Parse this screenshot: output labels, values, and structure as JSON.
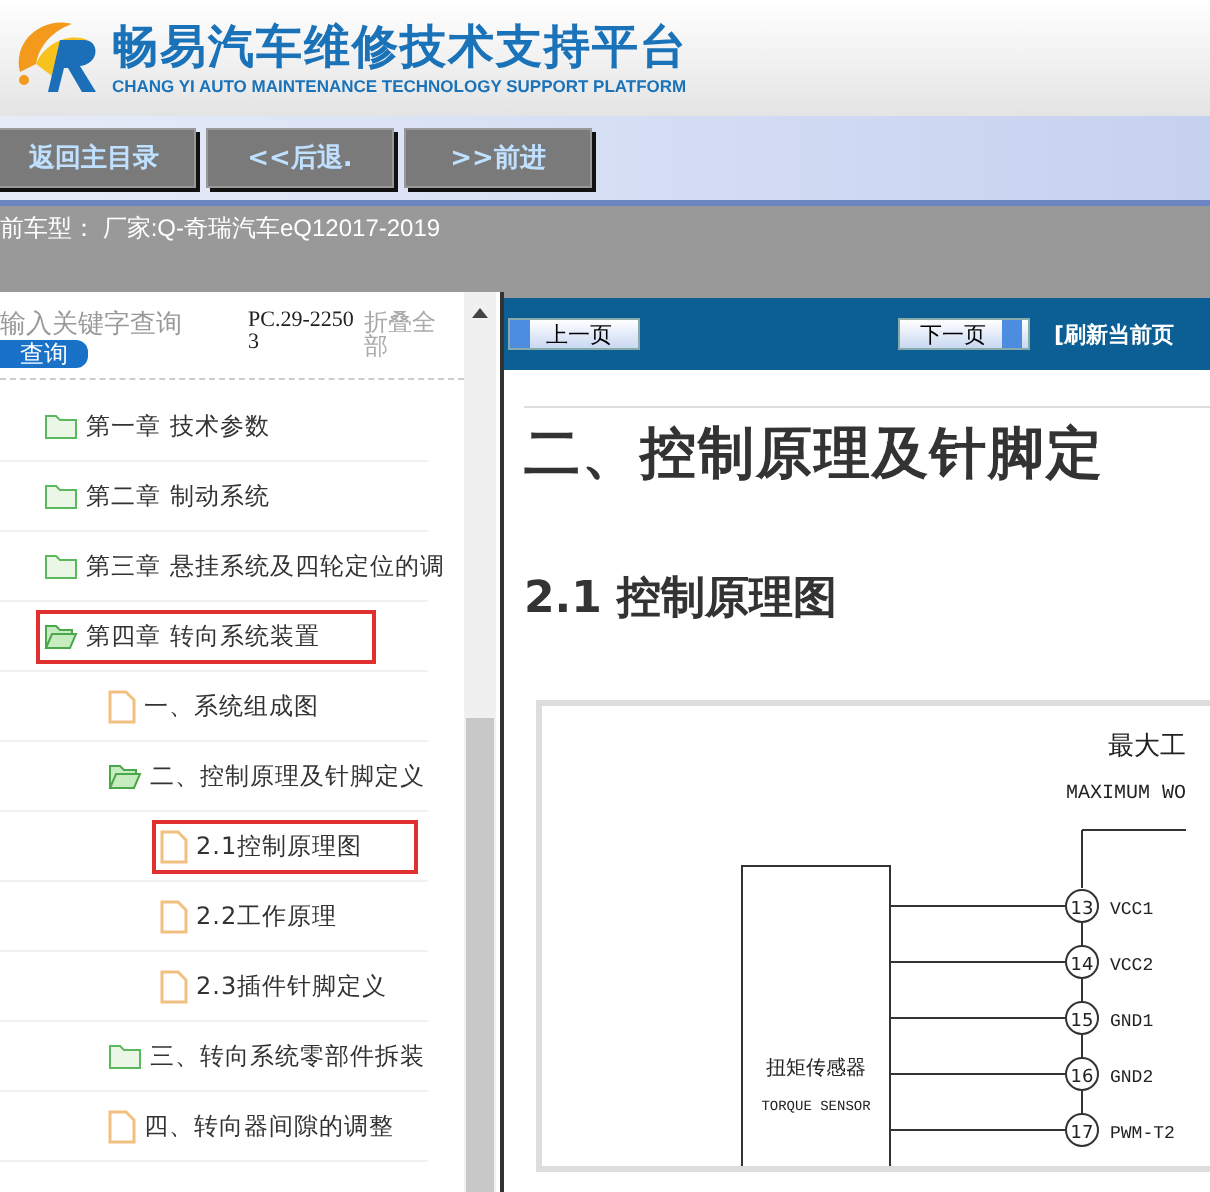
{
  "header": {
    "title": "畅易汽车维修技术支持平台",
    "subtitle": "CHANG YI AUTO MAINTENANCE TECHNOLOGY SUPPORT PLATFORM"
  },
  "nav_buttons": [
    "返回主目录",
    "<<后退.",
    ">>前进"
  ],
  "vehicle_info": "前车型： 厂家:Q-奇瑞汽车eQ12017-2019",
  "search": {
    "placeholder": "输入关键字查询",
    "button": "查询",
    "code": "PC.29-22503",
    "collapse": "折叠全部"
  },
  "tree": [
    {
      "kind": "folder",
      "label": "第一章 技术参数",
      "expanded": false,
      "highlighted": false
    },
    {
      "kind": "folder",
      "label": "第二章 制动系统",
      "expanded": false,
      "highlighted": false
    },
    {
      "kind": "folder",
      "label": "第三章 悬挂系统及四轮定位的调",
      "expanded": false,
      "highlighted": false
    },
    {
      "kind": "folder",
      "label": "第四章 转向系统装置",
      "expanded": true,
      "highlighted": true,
      "children": [
        {
          "kind": "page",
          "label": "一、系统组成图",
          "highlighted": false
        },
        {
          "kind": "folder",
          "label": "二、控制原理及针脚定义",
          "expanded": true,
          "highlighted": false,
          "children": [
            {
              "kind": "page",
              "label": "2.1控制原理图",
              "highlighted": true
            },
            {
              "kind": "page",
              "label": "2.2工作原理",
              "highlighted": false
            },
            {
              "kind": "page",
              "label": "2.3插件针脚定义",
              "highlighted": false
            }
          ]
        },
        {
          "kind": "folder",
          "label": "三、转向系统零部件拆装",
          "expanded": false,
          "highlighted": false
        },
        {
          "kind": "page",
          "label": "四、转向器间隙的调整",
          "highlighted": false
        }
      ]
    }
  ],
  "toolbar": {
    "prev": "上一页",
    "next": "下一页",
    "refresh": "[刷新当前页"
  },
  "content": {
    "heading": "二、控制原理及针脚定",
    "subheading": "2.1 控制原理图",
    "diagram": {
      "title": "最大工",
      "title_en": "MAXIMUM WO",
      "sensor": "扭矩传感器",
      "sensor_en": "TORQUE SENSOR",
      "pins": [
        {
          "number": "13",
          "label": "VCC1"
        },
        {
          "number": "14",
          "label": "VCC2"
        },
        {
          "number": "15",
          "label": "GND1"
        },
        {
          "number": "16",
          "label": "GND2"
        },
        {
          "number": "17",
          "label": "PWM-T2"
        }
      ]
    }
  }
}
